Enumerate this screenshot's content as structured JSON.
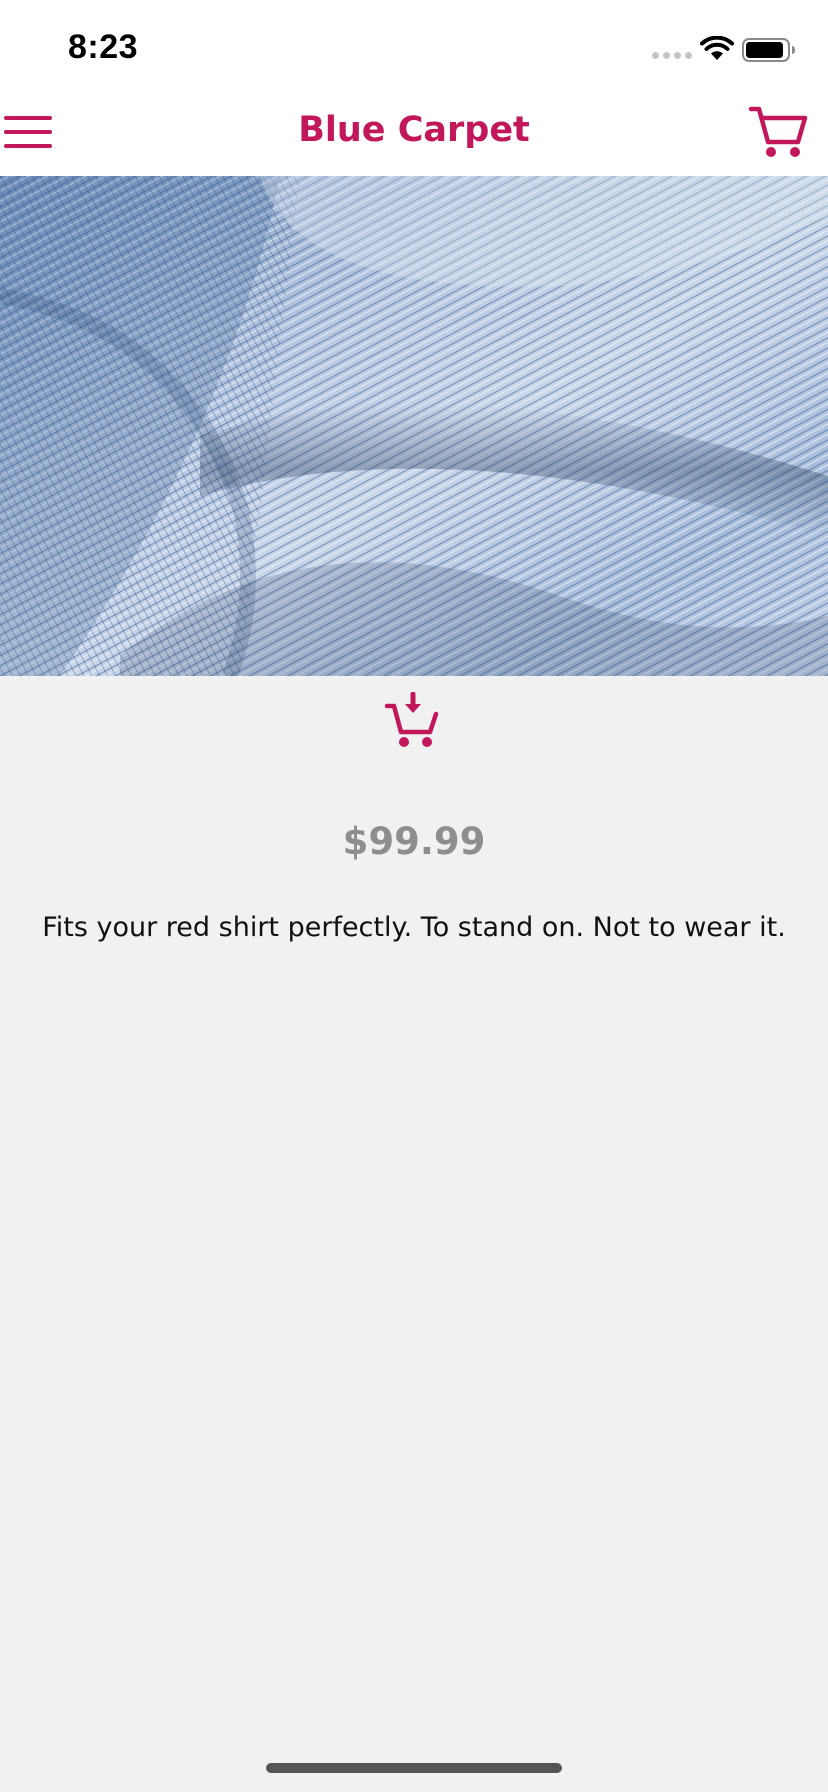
{
  "status_bar": {
    "time": "8:23"
  },
  "header": {
    "title": "Blue Carpet",
    "menu_icon": "hamburger-menu-icon",
    "cart_icon": "shopping-cart-icon"
  },
  "product": {
    "image": "blue-knit-fabric-photo",
    "add_to_cart_icon": "add-to-cart-icon",
    "price": "$99.99",
    "description": "Fits your red shirt perfectly. To stand on. Not to wear it."
  },
  "colors": {
    "accent": "#c2185b",
    "background": "#f1f1f1",
    "price_text": "#8e8e8e",
    "body_text": "#111111"
  }
}
